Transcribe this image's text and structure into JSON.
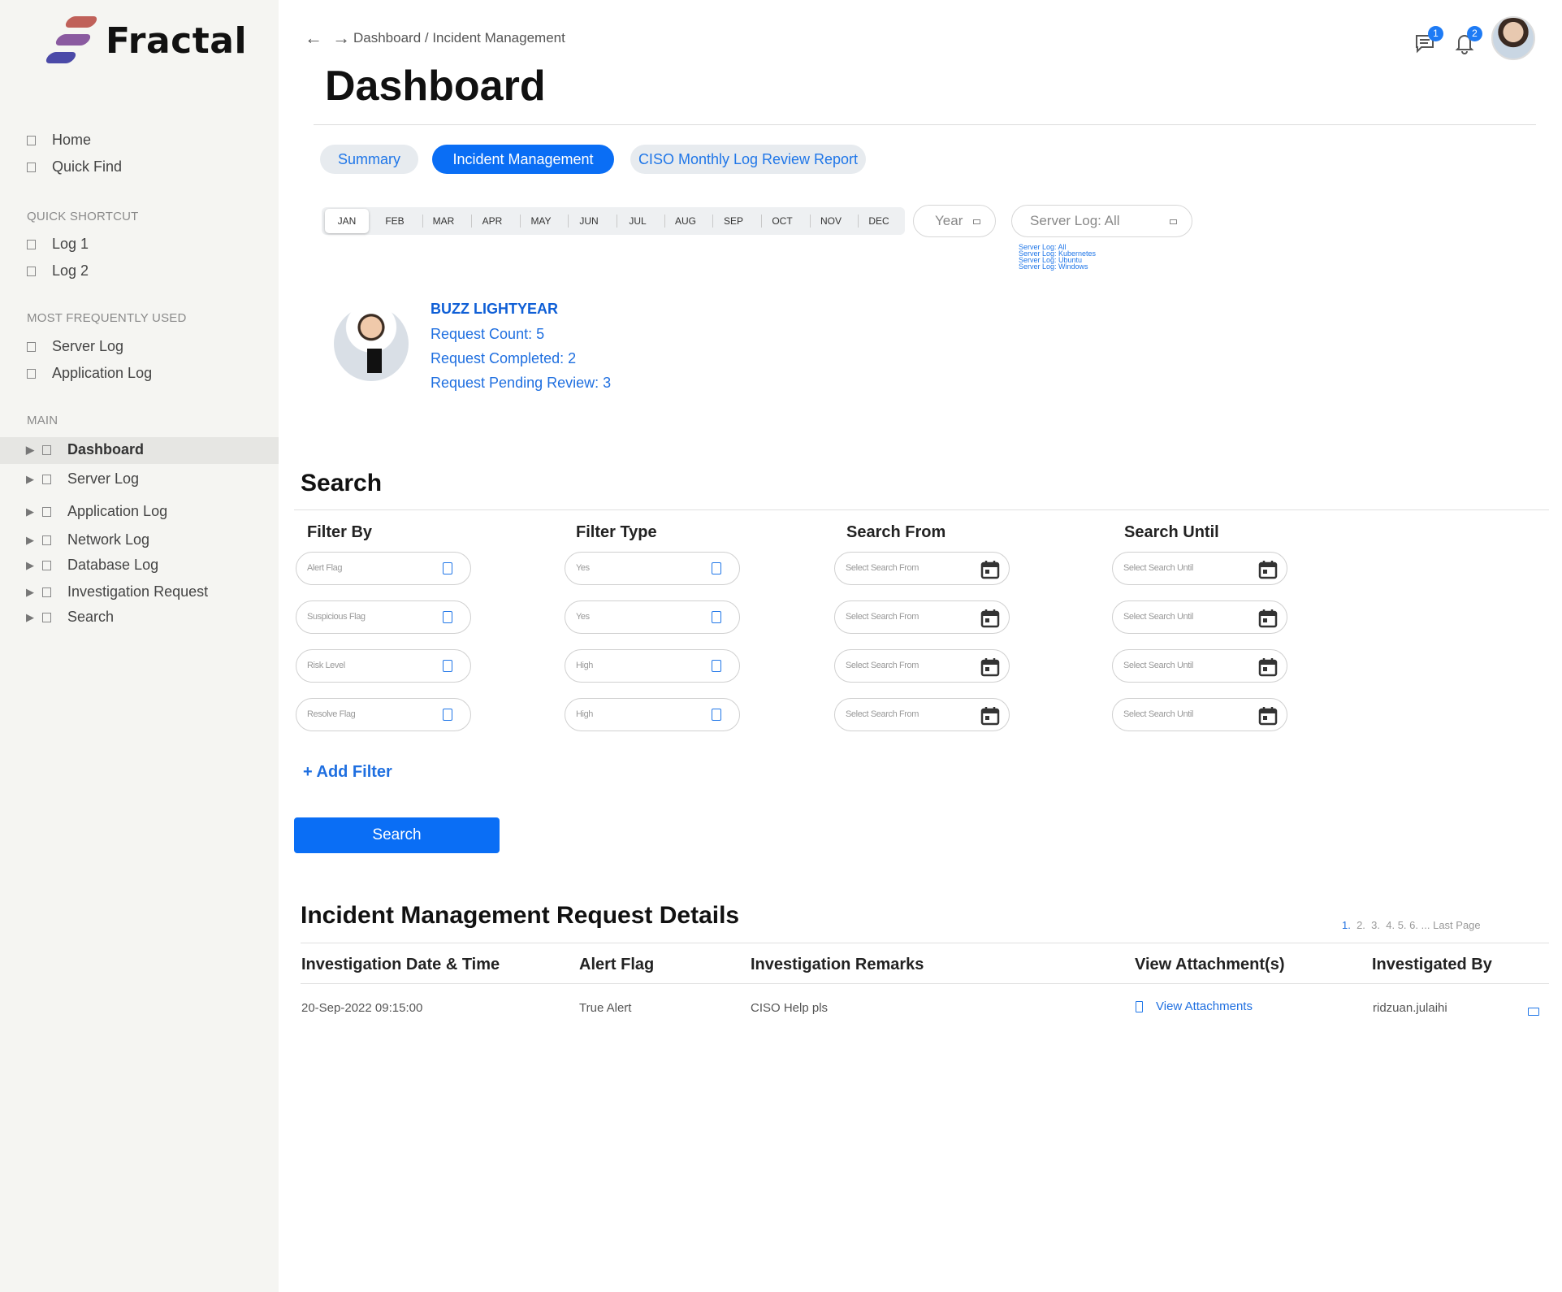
{
  "app": {
    "name": "Fractal"
  },
  "sidebar": {
    "top_items": [
      {
        "label": "Home"
      },
      {
        "label": "Quick Find"
      }
    ],
    "quick_shortcut": {
      "heading": "QUICK SHORTCUT",
      "items": [
        {
          "label": "Log 1"
        },
        {
          "label": "Log 2"
        }
      ]
    },
    "most_used": {
      "heading": "MOST FREQUENTLY USED",
      "items": [
        {
          "label": "Server Log"
        },
        {
          "label": "Application Log"
        }
      ]
    },
    "main": {
      "heading": "MAIN",
      "items": [
        {
          "label": "Dashboard",
          "active": true
        },
        {
          "label": "Server Log"
        },
        {
          "label": "Application Log"
        },
        {
          "label": "Network Log"
        },
        {
          "label": "Database Log"
        },
        {
          "label": "Investigation Request"
        },
        {
          "label": "Search"
        }
      ]
    }
  },
  "header": {
    "breadcrumb": "Dashboard / Incident Management",
    "title": "Dashboard",
    "messages_count": "1",
    "notifications_count": "2"
  },
  "tabs": [
    {
      "label": "Summary",
      "active": false
    },
    {
      "label": "Incident Management",
      "active": true
    },
    {
      "label": "CISO Monthly Log Review Report",
      "active": false
    }
  ],
  "months": [
    "JAN",
    "FEB",
    "MAR",
    "APR",
    "MAY",
    "JUN",
    "JUL",
    "AUG",
    "SEP",
    "OCT",
    "NOV",
    "DEC"
  ],
  "selected_month": "JAN",
  "year_dropdown": {
    "label": "Year"
  },
  "server_log_dropdown": {
    "label": "Server Log: All",
    "options": [
      "Server Log: All",
      "Server Log: Kubernetes",
      "Server Log: Ubuntu",
      "Server Log: Windows"
    ]
  },
  "profile": {
    "name": "BUZZ LIGHTYEAR",
    "request_count": "Request Count: 5",
    "request_completed": "Request Completed: 2",
    "request_pending": "Request Pending Review: 3"
  },
  "search": {
    "title": "Search",
    "columns": {
      "filter_by": "Filter By",
      "filter_type": "Filter Type",
      "search_from": "Search From",
      "search_until": "Search Until"
    },
    "rows": [
      {
        "filter_by": "Alert Flag",
        "filter_type": "Yes",
        "from": "Select Search From",
        "until": "Select Search Until"
      },
      {
        "filter_by": "Suspicious Flag",
        "filter_type": "Yes",
        "from": "Select Search From",
        "until": "Select Search Until"
      },
      {
        "filter_by": "Risk Level",
        "filter_type": "High",
        "from": "Select Search From",
        "until": "Select Search Until"
      },
      {
        "filter_by": "Resolve Flag",
        "filter_type": "High",
        "from": "Select Search From",
        "until": "Select Search Until"
      }
    ],
    "add_filter": "+ Add Filter",
    "button": "Search"
  },
  "details": {
    "title": "Incident Management Request Details",
    "pagination": {
      "pages": [
        "1.",
        "2.",
        "3.",
        "4.",
        "5.",
        "6."
      ],
      "more": "... Last Page"
    },
    "headers": {
      "date": "Investigation Date & Time",
      "alert_flag": "Alert Flag",
      "remarks": "Investigation Remarks",
      "attachments": "View Attachment(s)",
      "investigated_by": "Investigated By"
    },
    "rows": [
      {
        "date": "20-Sep-2022 09:15:00",
        "alert_flag": "True Alert",
        "remarks": "CISO Help pls",
        "attachments": "View Attachments",
        "investigated_by": "ridzuan.julaihi"
      }
    ]
  }
}
